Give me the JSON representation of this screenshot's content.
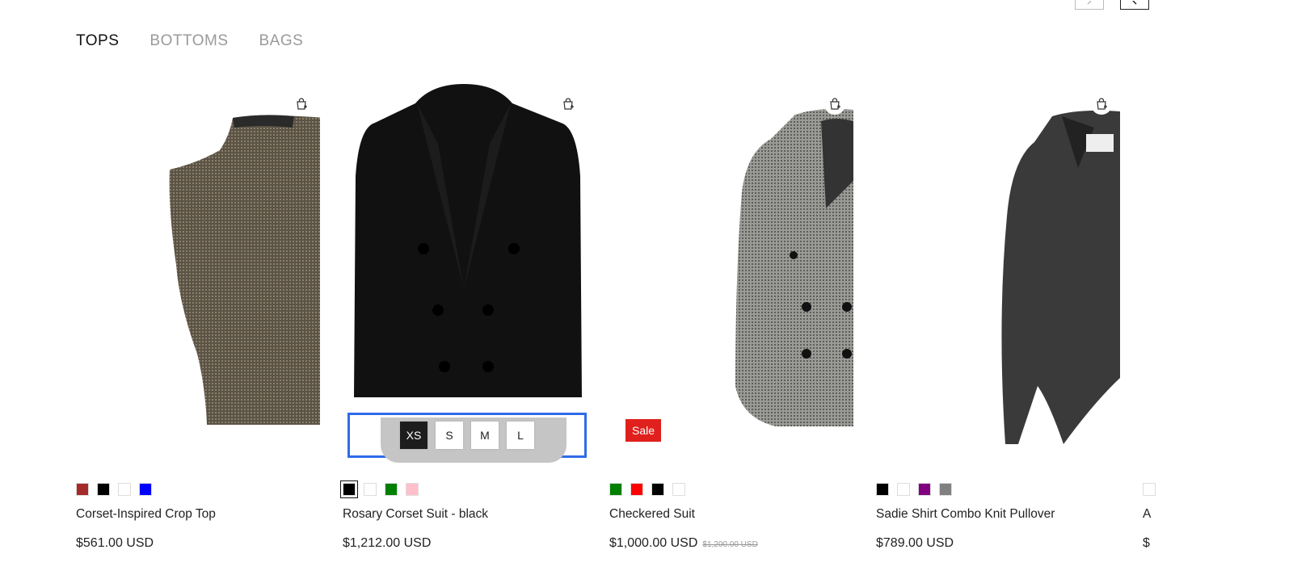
{
  "tabs": [
    {
      "label": "TOPS",
      "active": true
    },
    {
      "label": "BOTTOMS",
      "active": false
    },
    {
      "label": "BAGS",
      "active": false
    }
  ],
  "icons": {
    "cart": "add-to-cart-icon",
    "prev": "chevron-left-icon",
    "next": "chevron-right-icon"
  },
  "products": [
    {
      "name": "Corset-Inspired Crop Top",
      "price": "$561.00 USD",
      "colors": [
        "#a52a2a",
        "#000000",
        "#ffffff",
        "#0000ff"
      ],
      "image": "knit-turtleneck-top"
    },
    {
      "name": "Rosary Corset Suit - black",
      "price": "$1,212.00 USD",
      "colors": [
        "#000000",
        "#ffffff",
        "#008000",
        "#ffc0cb"
      ],
      "selected_color": 0,
      "sizes": [
        "XS",
        "S",
        "M",
        "L"
      ],
      "selected_size": "XS",
      "image": "black-double-breasted-blazer"
    },
    {
      "name": "Checkered Suit",
      "price": "$1,000.00 USD",
      "old_price": "$1,200.00 USD",
      "badge": "Sale",
      "colors": [
        "#008000",
        "#ff0000",
        "#000000",
        "#ffffff"
      ],
      "image": "houndstooth-blazer"
    },
    {
      "name": "Sadie Shirt Combo Knit Pullover",
      "price": "$789.00 USD",
      "colors": [
        "#000000",
        "#ffffff",
        "#800080",
        "#808080"
      ],
      "image": "grey-knit-pullover"
    },
    {
      "name": "A",
      "price": "$",
      "colors": [
        "#ffffff"
      ],
      "image": "partially-visible-product"
    }
  ],
  "colors": {
    "accent_focus": "#2f6be8",
    "sale": "#e0201c",
    "tab_inactive": "#9a9a9a"
  }
}
